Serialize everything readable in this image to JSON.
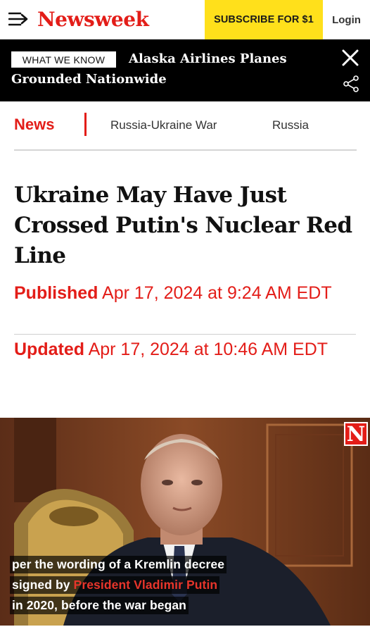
{
  "header": {
    "logo": "Newsweek",
    "subscribe_label": "SUBSCRIBE FOR $1",
    "login_label": "Login"
  },
  "banner": {
    "badge": "WHAT WE KNOW",
    "headline": "Alaska Airlines Planes Grounded Nationwide"
  },
  "nav": {
    "active": "News",
    "items": [
      "Russia-Ukraine War",
      "Russia"
    ]
  },
  "article": {
    "headline": "Ukraine May Have Just Crossed Putin's Nuclear Red Line",
    "published_label": "Published",
    "published_value": "Apr 17, 2024 at 9:24 AM EDT",
    "updated_label": "Updated",
    "updated_value": "Apr 17, 2024 at 10:46 AM EDT"
  },
  "video": {
    "badge": "N",
    "caption_line1": "per the wording of a Kremlin decree",
    "caption_line2_prefix": "signed by ",
    "caption_line2_highlight": "President Vladimir Putin",
    "caption_line3": "in 2020, before the war began"
  },
  "colors": {
    "brand_red": "#e31d18",
    "subscribe_yellow": "#ffe01b",
    "banner_black": "#000000"
  },
  "icons": [
    "menu-icon",
    "close-icon",
    "share-icon"
  ]
}
